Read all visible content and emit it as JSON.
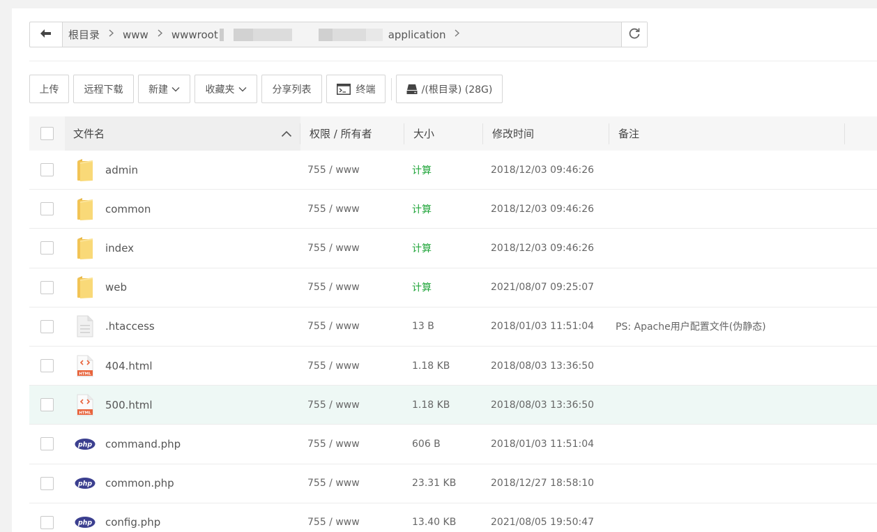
{
  "breadcrumb": {
    "items": [
      "根目录",
      "www",
      "wwwroot",
      "application"
    ]
  },
  "toolbar": {
    "upload": "上传",
    "remote_download": "远程下载",
    "new": "新建",
    "favorites": "收藏夹",
    "share_list": "分享列表",
    "terminal": "终端",
    "disk": "/(根目录) (28G)"
  },
  "table": {
    "columns": [
      "文件名",
      "权限 / 所有者",
      "大小",
      "修改时间",
      "备注"
    ],
    "rows": [
      {
        "icon": "folder-icon",
        "name": "admin",
        "perm": "755 / www",
        "size": "计算",
        "time": "2018/12/03 09:46:26",
        "note": ""
      },
      {
        "icon": "folder-icon",
        "name": "common",
        "perm": "755 / www",
        "size": "计算",
        "time": "2018/12/03 09:46:26",
        "note": ""
      },
      {
        "icon": "folder-icon",
        "name": "index",
        "perm": "755 / www",
        "size": "计算",
        "time": "2018/12/03 09:46:26",
        "note": ""
      },
      {
        "icon": "folder-icon",
        "name": "web",
        "perm": "755 / www",
        "size": "计算",
        "time": "2021/08/07 09:25:07",
        "note": ""
      },
      {
        "icon": "file-icon",
        "name": ".htaccess",
        "perm": "755 / www",
        "size": "13 B",
        "time": "2018/01/03 11:51:04",
        "note": "PS: Apache用户配置文件(伪静态)"
      },
      {
        "icon": "html-file-icon",
        "name": "404.html",
        "perm": "755 / www",
        "size": "1.18 KB",
        "time": "2018/08/03 13:36:50",
        "note": ""
      },
      {
        "icon": "html-file-icon",
        "name": "500.html",
        "perm": "755 / www",
        "size": "1.18 KB",
        "time": "2018/08/03 13:36:50",
        "note": ""
      },
      {
        "icon": "php-file-icon",
        "name": "command.php",
        "perm": "755 / www",
        "size": "606 B",
        "time": "2018/01/03 11:51:04",
        "note": ""
      },
      {
        "icon": "php-file-icon",
        "name": "common.php",
        "perm": "755 / www",
        "size": "23.31 KB",
        "time": "2018/12/27 18:58:10",
        "note": ""
      },
      {
        "icon": "php-file-icon",
        "name": "config.php",
        "perm": "755 / www",
        "size": "13.40 KB",
        "time": "2021/08/05 19:50:47",
        "note": ""
      }
    ]
  },
  "colors": {
    "accent_green": "#20a53a",
    "folder": "#f7d56b",
    "html_badge": "#e8643c",
    "php_badge": "#3b3f8f",
    "row_highlight": "#eef8f5"
  }
}
